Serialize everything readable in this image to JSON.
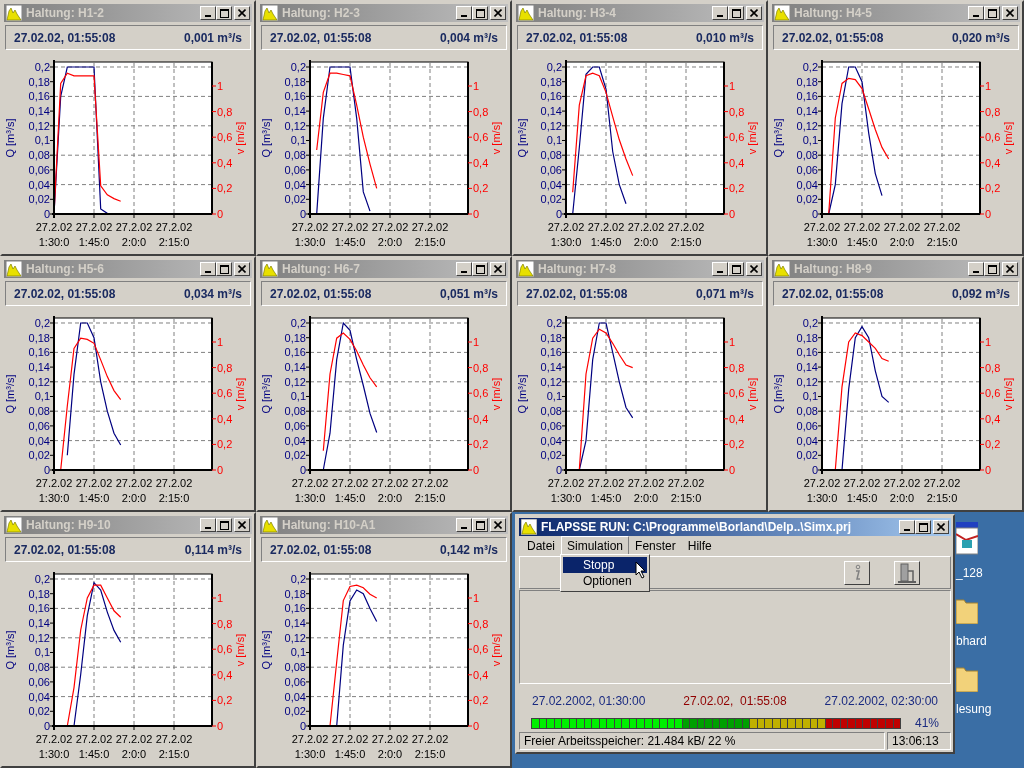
{
  "chart_windows": [
    {
      "title": "Haltung: H1-2",
      "date": "27.02.02, 01:55:08",
      "value": "0,001 m³/s",
      "chart_data": {
        "type": "line",
        "grid": true,
        "ylabel": "Q [m³/s]",
        "y2label": "v [m/s]",
        "ylim": [
          0,
          0.2068
        ],
        "y2lim": [
          0,
          1.1875
        ],
        "categories": [
          "27.2.02 1:30:0",
          null,
          null,
          null,
          null,
          null,
          "27.2.02 1:45:0",
          null,
          null,
          null,
          null,
          null,
          "27.2.02 2:0:0",
          null,
          null,
          null,
          null,
          null,
          "27.2.02 2:15:0",
          null,
          null,
          null,
          null,
          null
        ],
        "yticks": [
          {
            "value": 0,
            "label": "0"
          },
          {
            "value": 0.02,
            "label": "0,02"
          },
          {
            "value": 0.04,
            "label": "0,04"
          },
          {
            "value": 0.06,
            "label": "0,06"
          },
          {
            "value": 0.08,
            "label": "0,08"
          },
          {
            "value": 0.1,
            "label": "0,1"
          },
          {
            "value": 0.12,
            "label": "0,12"
          },
          {
            "value": 0.14,
            "label": "0,14"
          },
          {
            "value": 0.16,
            "label": "0,16"
          },
          {
            "value": 0.18,
            "label": "0,18"
          },
          {
            "value": 0.2,
            "label": "0,2"
          }
        ],
        "y2ticks": [
          {
            "value": 0,
            "label": "0"
          },
          {
            "value": 0.2,
            "label": "0,2"
          },
          {
            "value": 0.4,
            "label": "0,4"
          },
          {
            "value": 0.6,
            "label": "0,6"
          },
          {
            "value": 0.8,
            "label": "0,8"
          },
          {
            "value": 1,
            "label": "1"
          }
        ],
        "series": [
          {
            "color": "#000080",
            "values": [
              0,
              0.16,
              0.2,
              0.2,
              0.2,
              0.2,
              0.2,
              0.007,
              0.001,
              0,
              null,
              null,
              null,
              null,
              null,
              null,
              null,
              null,
              null,
              null,
              null,
              null,
              null,
              null
            ]
          },
          {
            "color": "#ff0000",
            "axis": "y2",
            "values": [
              0,
              1.02,
              1.1,
              1.08,
              1.08,
              1.08,
              1.08,
              0.22,
              0.15,
              0.12,
              0.1,
              null,
              null,
              null,
              null,
              null,
              null,
              null,
              null,
              null,
              null,
              null,
              null,
              null
            ]
          }
        ]
      }
    },
    {
      "title": "Haltung: H2-3",
      "date": "27.02.02, 01:55:08",
      "value": "0,004 m³/s",
      "chart_data": {
        "type": "line",
        "grid": true,
        "ylabel": "Q [m³/s]",
        "y2label": "v [m/s]",
        "ylim": [
          0,
          0.2068
        ],
        "y2lim": [
          0,
          1.1875
        ],
        "categories": [
          "27.2.02 1:30:0",
          null,
          null,
          null,
          null,
          null,
          "27.2.02 1:45:0",
          null,
          null,
          null,
          null,
          null,
          "27.2.02 2:0:0",
          null,
          null,
          null,
          null,
          null,
          "27.2.02 2:15:0",
          null,
          null,
          null,
          null,
          null
        ],
        "yticks": [
          {
            "value": 0,
            "label": "0"
          },
          {
            "value": 0.02,
            "label": "0,02"
          },
          {
            "value": 0.04,
            "label": "0,04"
          },
          {
            "value": 0.06,
            "label": "0,06"
          },
          {
            "value": 0.08,
            "label": "0,08"
          },
          {
            "value": 0.1,
            "label": "0,1"
          },
          {
            "value": 0.12,
            "label": "0,12"
          },
          {
            "value": 0.14,
            "label": "0,14"
          },
          {
            "value": 0.16,
            "label": "0,16"
          },
          {
            "value": 0.18,
            "label": "0,18"
          },
          {
            "value": 0.2,
            "label": "0,2"
          }
        ],
        "y2ticks": [
          {
            "value": 0,
            "label": "0"
          },
          {
            "value": 0.2,
            "label": "0,2"
          },
          {
            "value": 0.4,
            "label": "0,4"
          },
          {
            "value": 0.6,
            "label": "0,6"
          },
          {
            "value": 0.8,
            "label": "0,8"
          },
          {
            "value": 1,
            "label": "1"
          }
        ],
        "series": [
          {
            "color": "#000080",
            "values": [
              null,
              0,
              0.13,
              0.2,
              0.2,
              0.2,
              0.2,
              0.13,
              0.03,
              0.004,
              null,
              null,
              null,
              null,
              null,
              null,
              null,
              null,
              null,
              null,
              null,
              null,
              null,
              null
            ]
          },
          {
            "color": "#ff0000",
            "axis": "y2",
            "values": [
              null,
              0.5,
              0.95,
              1.1,
              1.1,
              1.09,
              1.08,
              0.85,
              0.6,
              0.39,
              0.2,
              null,
              null,
              null,
              null,
              null,
              null,
              null,
              null,
              null,
              null,
              null,
              null,
              null
            ]
          }
        ]
      }
    },
    {
      "title": "Haltung: H3-4",
      "date": "27.02.02, 01:55:08",
      "value": "0,010 m³/s",
      "chart_data": {
        "type": "line",
        "grid": true,
        "ylabel": "Q [m³/s]",
        "y2label": "v [m/s]",
        "ylim": [
          0,
          0.2068
        ],
        "y2lim": [
          0,
          1.1875
        ],
        "categories": [
          "27.2.02 1:30:0",
          null,
          null,
          null,
          null,
          null,
          "27.2.02 1:45:0",
          null,
          null,
          null,
          null,
          null,
          "27.2.02 2:0:0",
          null,
          null,
          null,
          null,
          null,
          "27.2.02 2:15:0",
          null,
          null,
          null,
          null,
          null
        ],
        "yticks": [
          {
            "value": 0,
            "label": "0"
          },
          {
            "value": 0.02,
            "label": "0,02"
          },
          {
            "value": 0.04,
            "label": "0,04"
          },
          {
            "value": 0.06,
            "label": "0,06"
          },
          {
            "value": 0.08,
            "label": "0,08"
          },
          {
            "value": 0.1,
            "label": "0,1"
          },
          {
            "value": 0.12,
            "label": "0,12"
          },
          {
            "value": 0.14,
            "label": "0,14"
          },
          {
            "value": 0.16,
            "label": "0,16"
          },
          {
            "value": 0.18,
            "label": "0,18"
          },
          {
            "value": 0.2,
            "label": "0,2"
          }
        ],
        "y2ticks": [
          {
            "value": 0,
            "label": "0"
          },
          {
            "value": 0.2,
            "label": "0,2"
          },
          {
            "value": 0.4,
            "label": "0,4"
          },
          {
            "value": 0.6,
            "label": "0,6"
          },
          {
            "value": 0.8,
            "label": "0,8"
          },
          {
            "value": 1,
            "label": "1"
          }
        ],
        "series": [
          {
            "color": "#000080",
            "values": [
              null,
              0,
              0.09,
              0.19,
              0.2,
              0.2,
              0.17,
              0.085,
              0.04,
              0.014,
              null,
              null,
              null,
              null,
              null,
              null,
              null,
              null,
              null,
              null,
              null,
              null,
              null,
              null
            ]
          },
          {
            "color": "#ff0000",
            "axis": "y2",
            "values": [
              null,
              0.17,
              0.85,
              1.08,
              1.1,
              1.08,
              0.95,
              0.76,
              0.58,
              0.43,
              0.3,
              null,
              null,
              null,
              null,
              null,
              null,
              null,
              null,
              null,
              null,
              null,
              null,
              null
            ]
          }
        ]
      }
    },
    {
      "title": "Haltung: H4-5",
      "date": "27.02.02, 01:55:08",
      "value": "0,020 m³/s",
      "chart_data": {
        "type": "line",
        "grid": true,
        "ylabel": "Q [m³/s]",
        "y2label": "v [m/s]",
        "ylim": [
          0,
          0.2068
        ],
        "y2lim": [
          0,
          1.1875
        ],
        "categories": [
          "27.2.02 1:30:0",
          null,
          null,
          null,
          null,
          null,
          "27.2.02 1:45:0",
          null,
          null,
          null,
          null,
          null,
          "27.2.02 2:0:0",
          null,
          null,
          null,
          null,
          null,
          "27.2.02 2:15:0",
          null,
          null,
          null,
          null,
          null
        ],
        "yticks": [
          {
            "value": 0,
            "label": "0"
          },
          {
            "value": 0.02,
            "label": "0,02"
          },
          {
            "value": 0.04,
            "label": "0,04"
          },
          {
            "value": 0.06,
            "label": "0,06"
          },
          {
            "value": 0.08,
            "label": "0,08"
          },
          {
            "value": 0.1,
            "label": "0,1"
          },
          {
            "value": 0.12,
            "label": "0,12"
          },
          {
            "value": 0.14,
            "label": "0,14"
          },
          {
            "value": 0.16,
            "label": "0,16"
          },
          {
            "value": 0.18,
            "label": "0,18"
          },
          {
            "value": 0.2,
            "label": "0,2"
          }
        ],
        "y2ticks": [
          {
            "value": 0,
            "label": "0"
          },
          {
            "value": 0.2,
            "label": "0,2"
          },
          {
            "value": 0.4,
            "label": "0,4"
          },
          {
            "value": 0.6,
            "label": "0,6"
          },
          {
            "value": 0.8,
            "label": "0,8"
          },
          {
            "value": 1,
            "label": "1"
          }
        ],
        "series": [
          {
            "color": "#000080",
            "values": [
              null,
              0,
              0.04,
              0.15,
              0.2,
              0.2,
              0.18,
              0.11,
              0.055,
              0.025,
              null,
              null,
              null,
              null,
              null,
              null,
              null,
              null,
              null,
              null,
              null,
              null,
              null,
              null
            ]
          },
          {
            "color": "#ff0000",
            "axis": "y2",
            "values": [
              null,
              0,
              0.75,
              1.02,
              1.06,
              1.05,
              0.98,
              0.82,
              0.66,
              0.52,
              0.43,
              null,
              null,
              null,
              null,
              null,
              null,
              null,
              null,
              null,
              null,
              null,
              null,
              null
            ]
          }
        ]
      }
    },
    {
      "title": "Haltung: H5-6",
      "date": "27.02.02, 01:55:08",
      "value": "0,034 m³/s",
      "chart_data": {
        "type": "line",
        "grid": true,
        "ylabel": "Q [m³/s]",
        "y2label": "v [m/s]",
        "ylim": [
          0,
          0.2068
        ],
        "y2lim": [
          0,
          1.1875
        ],
        "categories": [
          "27.2.02 1:30:0",
          null,
          null,
          null,
          null,
          null,
          "27.2.02 1:45:0",
          null,
          null,
          null,
          null,
          null,
          "27.2.02 2:0:0",
          null,
          null,
          null,
          null,
          null,
          "27.2.02 2:15:0",
          null,
          null,
          null,
          null,
          null
        ],
        "yticks": [
          {
            "value": 0,
            "label": "0"
          },
          {
            "value": 0.02,
            "label": "0,02"
          },
          {
            "value": 0.04,
            "label": "0,04"
          },
          {
            "value": 0.06,
            "label": "0,06"
          },
          {
            "value": 0.08,
            "label": "0,08"
          },
          {
            "value": 0.1,
            "label": "0,1"
          },
          {
            "value": 0.12,
            "label": "0,12"
          },
          {
            "value": 0.14,
            "label": "0,14"
          },
          {
            "value": 0.16,
            "label": "0,16"
          },
          {
            "value": 0.18,
            "label": "0,18"
          },
          {
            "value": 0.2,
            "label": "0,2"
          }
        ],
        "y2ticks": [
          {
            "value": 0,
            "label": "0"
          },
          {
            "value": 0.2,
            "label": "0,2"
          },
          {
            "value": 0.4,
            "label": "0,4"
          },
          {
            "value": 0.6,
            "label": "0,6"
          },
          {
            "value": 0.8,
            "label": "0,8"
          },
          {
            "value": 1,
            "label": "1"
          }
        ],
        "series": [
          {
            "color": "#000080",
            "values": [
              null,
              null,
              0.02,
              0.13,
              0.2,
              0.2,
              0.18,
              0.12,
              0.08,
              0.05,
              0.034,
              null,
              null,
              null,
              null,
              null,
              null,
              null,
              null,
              null,
              null,
              null,
              null,
              null
            ]
          },
          {
            "color": "#ff0000",
            "axis": "y2",
            "values": [
              null,
              0,
              0.5,
              0.95,
              1.03,
              1.02,
              0.99,
              0.86,
              0.73,
              0.62,
              0.55,
              null,
              null,
              null,
              null,
              null,
              null,
              null,
              null,
              null,
              null,
              null,
              null,
              null
            ]
          }
        ]
      }
    },
    {
      "title": "Haltung: H6-7",
      "date": "27.02.02, 01:55:08",
      "value": "0,051 m³/s",
      "chart_data": {
        "type": "line",
        "grid": true,
        "ylabel": "Q [m³/s]",
        "y2label": "v [m/s]",
        "ylim": [
          0,
          0.2068
        ],
        "y2lim": [
          0,
          1.1875
        ],
        "categories": [
          "27.2.02 1:30:0",
          null,
          null,
          null,
          null,
          null,
          "27.2.02 1:45:0",
          null,
          null,
          null,
          null,
          null,
          "27.2.02 2:0:0",
          null,
          null,
          null,
          null,
          null,
          "27.2.02 2:15:0",
          null,
          null,
          null,
          null,
          null
        ],
        "yticks": [
          {
            "value": 0,
            "label": "0"
          },
          {
            "value": 0.02,
            "label": "0,02"
          },
          {
            "value": 0.04,
            "label": "0,04"
          },
          {
            "value": 0.06,
            "label": "0,06"
          },
          {
            "value": 0.08,
            "label": "0,08"
          },
          {
            "value": 0.1,
            "label": "0,1"
          },
          {
            "value": 0.12,
            "label": "0,12"
          },
          {
            "value": 0.14,
            "label": "0,14"
          },
          {
            "value": 0.16,
            "label": "0,16"
          },
          {
            "value": 0.18,
            "label": "0,18"
          },
          {
            "value": 0.2,
            "label": "0,2"
          }
        ],
        "y2ticks": [
          {
            "value": 0,
            "label": "0"
          },
          {
            "value": 0.2,
            "label": "0,2"
          },
          {
            "value": 0.4,
            "label": "0,4"
          },
          {
            "value": 0.6,
            "label": "0,6"
          },
          {
            "value": 0.8,
            "label": "0,8"
          },
          {
            "value": 1,
            "label": "1"
          }
        ],
        "series": [
          {
            "color": "#000080",
            "values": [
              null,
              null,
              0,
              0.05,
              0.15,
              0.2,
              0.19,
              0.15,
              0.115,
              0.077,
              0.051,
              null,
              null,
              null,
              null,
              null,
              null,
              null,
              null,
              null,
              null,
              null,
              null,
              null
            ]
          },
          {
            "color": "#ff0000",
            "axis": "y2",
            "values": [
              null,
              null,
              0.15,
              0.75,
              1.03,
              1.07,
              1.02,
              0.93,
              0.82,
              0.72,
              0.65,
              null,
              null,
              null,
              null,
              null,
              null,
              null,
              null,
              null,
              null,
              null,
              null,
              null
            ]
          }
        ]
      }
    },
    {
      "title": "Haltung: H7-8",
      "date": "27.02.02, 01:55:08",
      "value": "0,071 m³/s",
      "chart_data": {
        "type": "line",
        "grid": true,
        "ylabel": "Q [m³/s]",
        "y2label": "v [m/s]",
        "ylim": [
          0,
          0.2068
        ],
        "y2lim": [
          0,
          1.1875
        ],
        "categories": [
          "27.2.02 1:30:0",
          null,
          null,
          null,
          null,
          null,
          "27.2.02 1:45:0",
          null,
          null,
          null,
          null,
          null,
          "27.2.02 2:0:0",
          null,
          null,
          null,
          null,
          null,
          "27.2.02 2:15:0",
          null,
          null,
          null,
          null,
          null
        ],
        "yticks": [
          {
            "value": 0,
            "label": "0"
          },
          {
            "value": 0.02,
            "label": "0,02"
          },
          {
            "value": 0.04,
            "label": "0,04"
          },
          {
            "value": 0.06,
            "label": "0,06"
          },
          {
            "value": 0.08,
            "label": "0,08"
          },
          {
            "value": 0.1,
            "label": "0,1"
          },
          {
            "value": 0.12,
            "label": "0,12"
          },
          {
            "value": 0.14,
            "label": "0,14"
          },
          {
            "value": 0.16,
            "label": "0,16"
          },
          {
            "value": 0.18,
            "label": "0,18"
          },
          {
            "value": 0.2,
            "label": "0,2"
          }
        ],
        "y2ticks": [
          {
            "value": 0,
            "label": "0"
          },
          {
            "value": 0.2,
            "label": "0,2"
          },
          {
            "value": 0.4,
            "label": "0,4"
          },
          {
            "value": 0.6,
            "label": "0,6"
          },
          {
            "value": 0.8,
            "label": "0,8"
          },
          {
            "value": 1,
            "label": "1"
          }
        ],
        "series": [
          {
            "color": "#000080",
            "values": [
              null,
              null,
              0,
              0.04,
              0.15,
              0.2,
              0.2,
              0.16,
              0.12,
              0.085,
              0.071,
              null,
              null,
              null,
              null,
              null,
              null,
              null,
              null,
              null,
              null,
              null,
              null,
              null
            ]
          },
          {
            "color": "#ff0000",
            "axis": "y2",
            "values": [
              null,
              null,
              0,
              0.75,
              1.03,
              1.1,
              1.07,
              0.99,
              0.9,
              0.82,
              0.8,
              null,
              null,
              null,
              null,
              null,
              null,
              null,
              null,
              null,
              null,
              null,
              null,
              null
            ]
          }
        ]
      }
    },
    {
      "title": "Haltung: H8-9",
      "date": "27.02.02, 01:55:08",
      "value": "0,092 m³/s",
      "chart_data": {
        "type": "line",
        "grid": true,
        "ylabel": "Q [m³/s]",
        "y2label": "v [m/s]",
        "ylim": [
          0,
          0.2068
        ],
        "y2lim": [
          0,
          1.1875
        ],
        "categories": [
          "27.2.02 1:30:0",
          null,
          null,
          null,
          null,
          null,
          "27.2.02 1:45:0",
          null,
          null,
          null,
          null,
          null,
          "27.2.02 2:0:0",
          null,
          null,
          null,
          null,
          null,
          "27.2.02 2:15:0",
          null,
          null,
          null,
          null,
          null
        ],
        "yticks": [
          {
            "value": 0,
            "label": "0"
          },
          {
            "value": 0.02,
            "label": "0,02"
          },
          {
            "value": 0.04,
            "label": "0,04"
          },
          {
            "value": 0.06,
            "label": "0,06"
          },
          {
            "value": 0.08,
            "label": "0,08"
          },
          {
            "value": 0.1,
            "label": "0,1"
          },
          {
            "value": 0.12,
            "label": "0,12"
          },
          {
            "value": 0.14,
            "label": "0,14"
          },
          {
            "value": 0.16,
            "label": "0,16"
          },
          {
            "value": 0.18,
            "label": "0,18"
          },
          {
            "value": 0.2,
            "label": "0,2"
          }
        ],
        "y2ticks": [
          {
            "value": 0,
            "label": "0"
          },
          {
            "value": 0.2,
            "label": "0,2"
          },
          {
            "value": 0.4,
            "label": "0,4"
          },
          {
            "value": 0.6,
            "label": "0,6"
          },
          {
            "value": 0.8,
            "label": "0,8"
          },
          {
            "value": 1,
            "label": "1"
          }
        ],
        "series": [
          {
            "color": "#000080",
            "values": [
              null,
              null,
              null,
              0,
              0.11,
              0.18,
              0.195,
              0.18,
              0.135,
              0.1,
              0.092,
              null,
              null,
              null,
              null,
              null,
              null,
              null,
              null,
              null,
              null,
              null,
              null,
              null
            ]
          },
          {
            "color": "#ff0000",
            "axis": "y2",
            "values": [
              null,
              null,
              0,
              0.65,
              1.0,
              1.07,
              1.05,
              1.0,
              0.95,
              0.87,
              0.85,
              null,
              null,
              null,
              null,
              null,
              null,
              null,
              null,
              null,
              null,
              null,
              null,
              null
            ]
          }
        ]
      }
    },
    {
      "title": "Haltung: H9-10",
      "date": "27.02.02, 01:55:08",
      "value": "0,114 m³/s",
      "chart_data": {
        "type": "line",
        "grid": true,
        "ylabel": "Q [m³/s]",
        "y2label": "v [m/s]",
        "ylim": [
          0,
          0.2068
        ],
        "y2lim": [
          0,
          1.1875
        ],
        "categories": [
          "27.2.02 1:30:0",
          null,
          null,
          null,
          null,
          null,
          "27.2.02 1:45:0",
          null,
          null,
          null,
          null,
          null,
          "27.2.02 2:0:0",
          null,
          null,
          null,
          null,
          null,
          "27.2.02 2:15:0",
          null,
          null,
          null,
          null,
          null
        ],
        "yticks": [
          {
            "value": 0,
            "label": "0"
          },
          {
            "value": 0.02,
            "label": "0,02"
          },
          {
            "value": 0.04,
            "label": "0,04"
          },
          {
            "value": 0.06,
            "label": "0,06"
          },
          {
            "value": 0.08,
            "label": "0,08"
          },
          {
            "value": 0.1,
            "label": "0,1"
          },
          {
            "value": 0.12,
            "label": "0,12"
          },
          {
            "value": 0.14,
            "label": "0,14"
          },
          {
            "value": 0.16,
            "label": "0,16"
          },
          {
            "value": 0.18,
            "label": "0,18"
          },
          {
            "value": 0.2,
            "label": "0,2"
          }
        ],
        "y2ticks": [
          {
            "value": 0,
            "label": "0"
          },
          {
            "value": 0.2,
            "label": "0,2"
          },
          {
            "value": 0.4,
            "label": "0,4"
          },
          {
            "value": 0.6,
            "label": "0,6"
          },
          {
            "value": 0.8,
            "label": "0,8"
          },
          {
            "value": 1,
            "label": "1"
          }
        ],
        "series": [
          {
            "color": "#000080",
            "values": [
              null,
              null,
              null,
              0,
              0.07,
              0.15,
              0.195,
              0.185,
              0.155,
              0.13,
              0.114,
              null,
              null,
              null,
              null,
              null,
              null,
              null,
              null,
              null,
              null,
              null,
              null,
              null
            ]
          },
          {
            "color": "#ff0000",
            "axis": "y2",
            "values": [
              null,
              null,
              0,
              0.3,
              0.75,
              1.0,
              1.1,
              1.1,
              1.0,
              0.9,
              0.85,
              null,
              null,
              null,
              null,
              null,
              null,
              null,
              null,
              null,
              null,
              null,
              null,
              null
            ]
          }
        ]
      }
    },
    {
      "title": "Haltung: H10-A1",
      "date": "27.02.02, 01:55:08",
      "value": "0,142 m³/s",
      "chart_data": {
        "type": "line",
        "grid": true,
        "ylabel": "Q [m³/s]",
        "y2label": "v [m/s]",
        "ylim": [
          0,
          0.2068
        ],
        "y2lim": [
          0,
          1.1875
        ],
        "categories": [
          "27.2.02 1:30:0",
          null,
          null,
          null,
          null,
          null,
          "27.2.02 1:45:0",
          null,
          null,
          null,
          null,
          null,
          "27.2.02 2:0:0",
          null,
          null,
          null,
          null,
          null,
          "27.2.02 2:15:0",
          null,
          null,
          null,
          null,
          null
        ],
        "yticks": [
          {
            "value": 0,
            "label": "0"
          },
          {
            "value": 0.02,
            "label": "0,02"
          },
          {
            "value": 0.04,
            "label": "0,04"
          },
          {
            "value": 0.06,
            "label": "0,06"
          },
          {
            "value": 0.08,
            "label": "0,08"
          },
          {
            "value": 0.1,
            "label": "0,1"
          },
          {
            "value": 0.12,
            "label": "0,12"
          },
          {
            "value": 0.14,
            "label": "0,14"
          },
          {
            "value": 0.16,
            "label": "0,16"
          },
          {
            "value": 0.18,
            "label": "0,18"
          },
          {
            "value": 0.2,
            "label": "0,2"
          }
        ],
        "y2ticks": [
          {
            "value": 0,
            "label": "0"
          },
          {
            "value": 0.2,
            "label": "0,2"
          },
          {
            "value": 0.4,
            "label": "0,4"
          },
          {
            "value": 0.6,
            "label": "0,6"
          },
          {
            "value": 0.8,
            "label": "0,8"
          },
          {
            "value": 1,
            "label": "1"
          }
        ],
        "series": [
          {
            "color": "#000080",
            "values": [
              null,
              null,
              null,
              null,
              0,
              0.11,
              0.17,
              0.185,
              0.18,
              0.16,
              0.142,
              null,
              null,
              null,
              null,
              null,
              null,
              null,
              null,
              null,
              null,
              null,
              null,
              null
            ]
          },
          {
            "color": "#ff0000",
            "axis": "y2",
            "values": [
              null,
              null,
              null,
              0,
              0.5,
              0.98,
              1.09,
              1.1,
              1.08,
              1.03,
              1.0,
              null,
              null,
              null,
              null,
              null,
              null,
              null,
              null,
              null,
              null,
              null,
              null,
              null
            ]
          }
        ]
      }
    }
  ],
  "main_window": {
    "title": "FLAPSSE RUN: C:\\Programme\\Borland\\Delp..\\Simx.prj",
    "menu": [
      {
        "label": "Datei",
        "selected": false
      },
      {
        "label": "Simulation",
        "selected": true
      },
      {
        "label": "Fenster",
        "selected": false
      },
      {
        "label": "Hilfe",
        "selected": false
      }
    ],
    "dropdown": [
      {
        "label": "Stopp",
        "selected": true
      },
      {
        "label": "Optionen",
        "selected": false
      }
    ],
    "start": "27.02.2002, 01:30:00",
    "current": "27.02.02,  01:55:08",
    "end": "27.02.2002, 02:30:00",
    "progress": {
      "level": 0.41,
      "reading": "41%"
    },
    "status": {
      "memory": "Freier Arbeitsspeicher: 21.484 kB/ 22 %",
      "time": "13:06:13"
    }
  },
  "desktop_icons": [
    {
      "kind": "program",
      "label": "_128"
    },
    {
      "kind": "folder",
      "label": "bhard"
    },
    {
      "kind": "folder",
      "label": "lesung"
    }
  ]
}
